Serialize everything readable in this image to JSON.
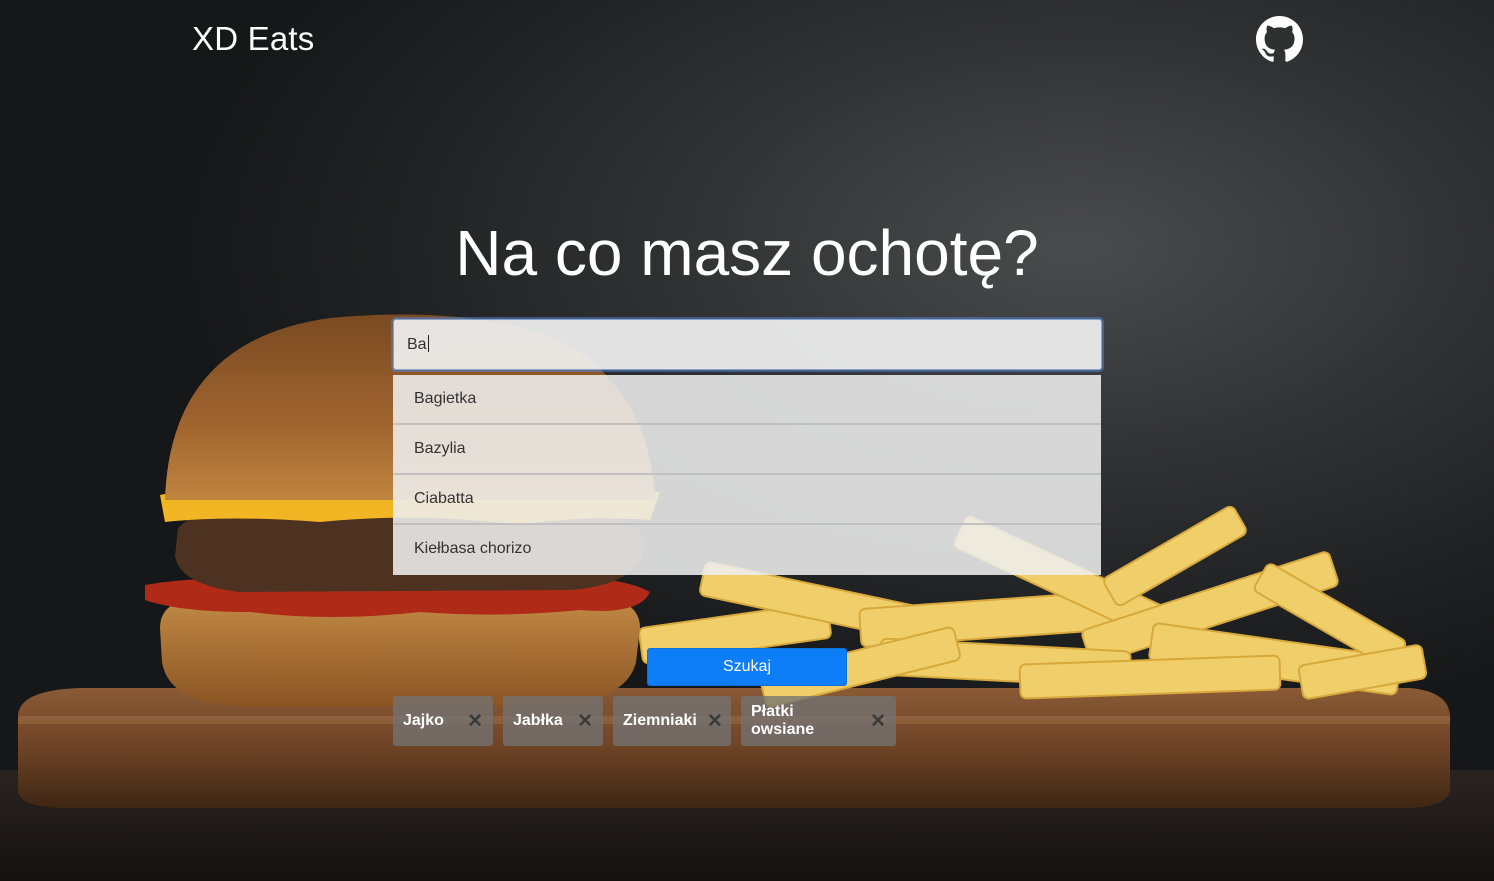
{
  "header": {
    "brand": "XD Eats",
    "github_icon": "github-icon"
  },
  "hero": {
    "title": "Na co masz ochotę?"
  },
  "search": {
    "value": "Ba",
    "suggestions": [
      {
        "label": "Bagietka"
      },
      {
        "label": "Bazylia"
      },
      {
        "label": "Ciabatta"
      },
      {
        "label": "Kiełbasa chorizo"
      }
    ],
    "button_label": "Szukaj"
  },
  "selected_ingredients": [
    {
      "label": "Jajko",
      "remove_icon": "close-icon"
    },
    {
      "label": "Jabłka",
      "remove_icon": "close-icon"
    },
    {
      "label": "Ziemniaki",
      "remove_icon": "close-icon"
    },
    {
      "label": "Płatki owsiane",
      "remove_icon": "close-icon"
    }
  ],
  "colors": {
    "primary": "#0d7ef7",
    "chip": "#737373",
    "text_light": "#ffffff"
  }
}
